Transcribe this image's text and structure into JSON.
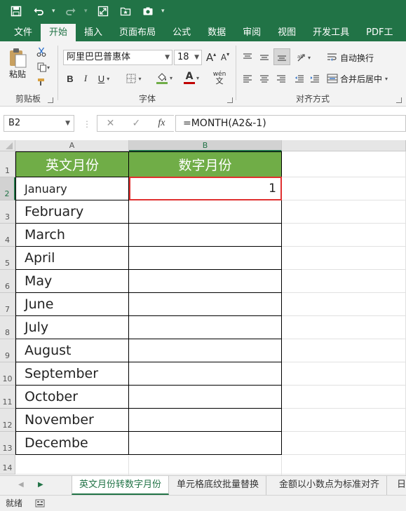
{
  "tabs": [
    "文件",
    "开始",
    "插入",
    "页面布局",
    "公式",
    "数据",
    "审阅",
    "视图",
    "开发工具",
    "PDF工"
  ],
  "active_tab": "开始",
  "ribbon": {
    "clipboard": {
      "paste_label": "粘贴",
      "group_label": "剪贴板"
    },
    "font": {
      "font_name": "阿里巴巴普惠体",
      "font_size": "18",
      "grow_label": "A",
      "shrink_label": "A",
      "bold": "B",
      "italic": "I",
      "underline": "U",
      "font_color_label": "A",
      "phonetic_label": "wén",
      "group_label": "字体"
    },
    "alignment": {
      "wrap_label": "自动换行",
      "merge_label": "合并后居中",
      "group_label": "对齐方式"
    }
  },
  "formula_bar": {
    "name_box": "B2",
    "cancel": "✕",
    "enter": "✓",
    "fx": "fx",
    "formula": "=MONTH(A2&-1)"
  },
  "grid": {
    "col_headers": [
      "A",
      "B"
    ],
    "row_headers": [
      "1",
      "2",
      "3",
      "4",
      "5",
      "6",
      "7",
      "8",
      "9",
      "10",
      "11",
      "12",
      "13",
      "14"
    ],
    "header_row": [
      "英文月份",
      "数字月份"
    ],
    "months": [
      "January",
      "February",
      "March",
      "April",
      "May",
      "June",
      "July",
      "August",
      "September",
      "October",
      "November",
      "Decembe"
    ],
    "b2_value": "1"
  },
  "sheet_tabs": [
    "英文月份转数字月份",
    "单元格底纹批量替换",
    "金额以小数点为标准对齐",
    "日"
  ],
  "active_sheet": "英文月份转数字月份",
  "status": {
    "ready": "就绪"
  },
  "colors": {
    "accent": "#217346",
    "header_fill": "#70ad47",
    "selection": "#e03030"
  }
}
